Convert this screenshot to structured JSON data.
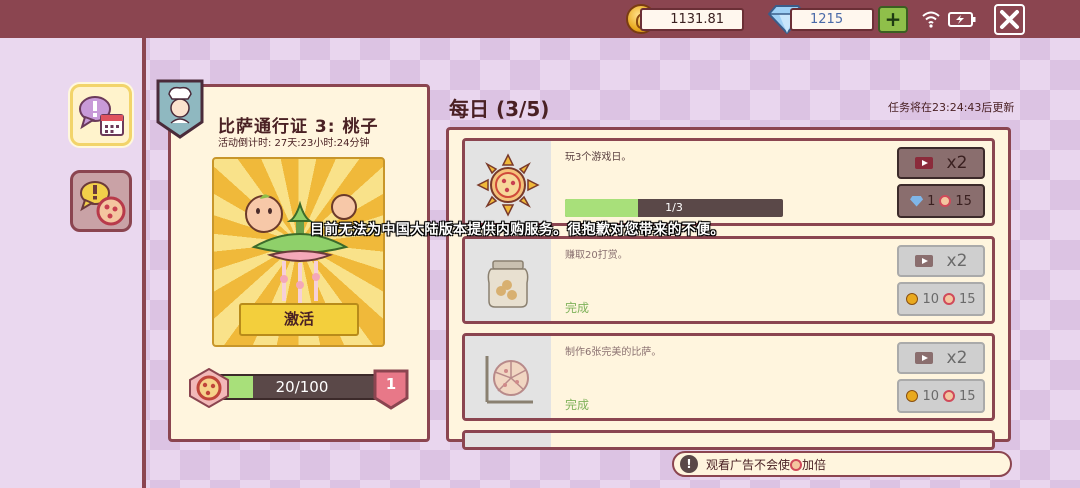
{
  "topbar": {
    "coins": "1131.81",
    "gems": "1215",
    "add_label": "+"
  },
  "sidebar": {
    "tabs": [
      {
        "name": "daily-tasks",
        "icon": "chat-calendar-icon"
      },
      {
        "name": "pizza-pass",
        "icon": "chat-pizza-icon"
      }
    ]
  },
  "pass": {
    "title": "比萨通行证 3: 桃子",
    "countdown": "活动倒计时: 27天:23小时:24分钟",
    "activate_label": "激活",
    "progress_text": "20/100",
    "progress_ratio": 0.2,
    "level": "1"
  },
  "daily": {
    "title": "每日 (3/5)",
    "refresh_text": "任务将在23:24:43后更新"
  },
  "tasks": [
    {
      "description": "玩3个游戏日。",
      "progress_text": "1/3",
      "progress_ratio": 0.333,
      "ad_multiplier": "x2",
      "reward_a": "1",
      "reward_b": "15",
      "thumb_icon": "sun-pizza-icon"
    },
    {
      "description": "赚取20打赏。",
      "status": "完成",
      "ad_multiplier": "x2",
      "reward_a": "10",
      "reward_b": "15",
      "thumb_icon": "tip-jar-icon"
    },
    {
      "description": "制作6张完美的比萨。",
      "status": "完成",
      "ad_multiplier": "x2",
      "reward_a": "10",
      "reward_b": "15",
      "thumb_icon": "pizza-slice-icon"
    }
  ],
  "toast": "目前无法为中国大陆版本提供内购服务。很抱歉对您带来的不便。",
  "ad_notice": {
    "before": "观看广告不会使",
    "after": "加倍"
  },
  "colors": {
    "frame": "#8b4550",
    "panel": "#fff5de",
    "progress_fill": "#a8e07a",
    "button_gold": "#f3cf3c"
  }
}
